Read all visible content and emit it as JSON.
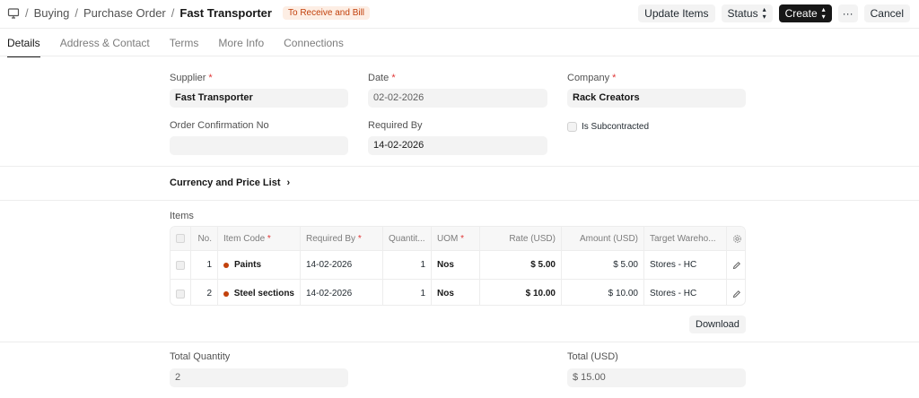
{
  "breadcrumbs": {
    "items": [
      "Buying",
      "Purchase Order"
    ],
    "separator": "/",
    "current": "Fast Transporter"
  },
  "status_badge": "To Receive and Bill",
  "actions": {
    "update_items": "Update Items",
    "status": "Status",
    "create": "Create",
    "more": "···",
    "cancel": "Cancel"
  },
  "tabs": [
    {
      "label": "Details",
      "active": true
    },
    {
      "label": "Address & Contact"
    },
    {
      "label": "Terms"
    },
    {
      "label": "More Info"
    },
    {
      "label": "Connections"
    }
  ],
  "form": {
    "supplier": {
      "label": "Supplier",
      "value": "Fast Transporter"
    },
    "date": {
      "label": "Date",
      "value": "02-02-2026"
    },
    "company": {
      "label": "Company",
      "value": "Rack Creators"
    },
    "order_confirmation_no": {
      "label": "Order Confirmation No",
      "value": ""
    },
    "required_by": {
      "label": "Required By",
      "value": "14-02-2026"
    },
    "is_subcontracted": {
      "label": "Is Subcontracted",
      "checked": false
    },
    "required_marker": "*"
  },
  "currency_section": {
    "label": "Currency and Price List",
    "chevron": "›"
  },
  "items": {
    "label": "Items",
    "columns": [
      "No.",
      "Item Code",
      "Required By",
      "Quantit...",
      "UOM",
      "Rate (USD)",
      "Amount (USD)",
      "Target Wareho..."
    ],
    "rows": [
      {
        "no": "1",
        "item_code": "Paints",
        "required_by": "14-02-2026",
        "qty": "1",
        "uom": "Nos",
        "rate": "$ 5.00",
        "amount": "$ 5.00",
        "warehouse": "Stores - HC"
      },
      {
        "no": "2",
        "item_code": "Steel sections",
        "required_by": "14-02-2026",
        "qty": "1",
        "uom": "Nos",
        "rate": "$ 10.00",
        "amount": "$ 10.00",
        "warehouse": "Stores - HC"
      }
    ],
    "download": "Download"
  },
  "totals": {
    "total_quantity": {
      "label": "Total Quantity",
      "value": "2"
    },
    "total_usd": {
      "label": "Total (USD)",
      "value": "$ 15.00"
    }
  },
  "colors": {
    "accent": "#171717",
    "required": "#e03636",
    "badge_bg": "#fdeee4",
    "badge_text": "#c2410c",
    "item_dot": "#c2410c"
  },
  "icons": {
    "desk": "monitor-icon",
    "settings": "gear-icon",
    "edit": "pencil-icon",
    "status_toggle": "updown-icon"
  }
}
